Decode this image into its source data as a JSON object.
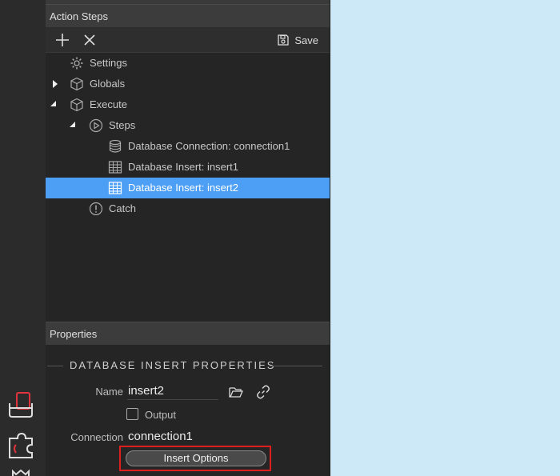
{
  "action_steps": {
    "header": "Action Steps",
    "toolbar": {
      "save_label": "Save"
    },
    "tree": [
      {
        "label": "Settings"
      },
      {
        "label": "Globals"
      },
      {
        "label": "Execute"
      },
      {
        "label": "Steps"
      },
      {
        "label": "Database Connection: connection1"
      },
      {
        "label": "Database Insert: insert1"
      },
      {
        "label": "Database Insert: insert2",
        "selected": true
      },
      {
        "label": "Catch"
      }
    ]
  },
  "properties": {
    "header": "Properties",
    "section_title": "DATABASE INSERT PROPERTIES",
    "name_label": "Name",
    "name_value": "insert2",
    "output_label": "Output",
    "output_checked": false,
    "connection_label": "Connection",
    "connection_value": "connection1",
    "insert_options_label": "Insert Options"
  },
  "colors": {
    "selection": "#4d9ff5",
    "highlight_border": "#e01e1e",
    "canvas": "#cde9f8"
  }
}
